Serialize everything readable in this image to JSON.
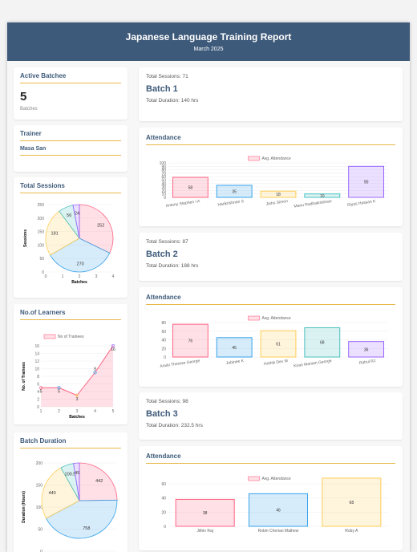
{
  "header": {
    "title": "Japanese Language Training Report",
    "subtitle": "March 2025"
  },
  "active": {
    "title": "Active Batchee",
    "count": "5",
    "label": "Batches"
  },
  "trainer": {
    "title": "Trainer",
    "name": "Masa San"
  },
  "sessions_card": {
    "title": "Total Sessions"
  },
  "learners_card": {
    "title": "No.of Learners"
  },
  "duration_card": {
    "title": "Batch Duration"
  },
  "batches": [
    {
      "sessions": "Total Sessions: 71",
      "name": "Batch 1",
      "duration": "Total Duration: 140 hrs",
      "att_title": "Attendance"
    },
    {
      "sessions": "Total Sessions: 87",
      "name": "Batch 2",
      "duration": "Total Duration: 188 hrs",
      "att_title": "Attendance"
    },
    {
      "sessions": "Total Sessions: 98",
      "name": "Batch 3",
      "duration": "Total Duration: 232.5 hrs",
      "att_title": "Attendance"
    }
  ],
  "colors": {
    "header": "#3e5a7a",
    "accent": "#e8b84a",
    "pink": "#ff6384",
    "blue": "#36a2eb",
    "yellow": "#ffce56",
    "teal": "#4bc0c0",
    "purple": "#9966ff"
  },
  "chart_data": [
    {
      "type": "pie",
      "ylabel": "Sessions",
      "xlabel": "Batches",
      "ylim": [
        0,
        250
      ],
      "xlim": [
        0,
        4
      ],
      "values": [
        252,
        270,
        181,
        56,
        24
      ]
    },
    {
      "type": "line",
      "legend": "No of Trainees",
      "ylabel": "No. of Trainees",
      "xlabel": "Batches",
      "x": [
        1,
        2,
        3,
        4,
        5
      ],
      "values": [
        5,
        5,
        3,
        9,
        16
      ],
      "ylim": [
        0,
        16
      ]
    },
    {
      "type": "pie",
      "ylabel": "Duration (Hours)",
      "ylim": [
        0,
        200
      ],
      "values": [
        442,
        758,
        440,
        100.5,
        45
      ]
    },
    {
      "type": "bar",
      "legend": "Avg. Attendance",
      "ylim": [
        0,
        100
      ],
      "categories": [
        "Antony Stephen I A",
        "Harikrishnan S",
        "Jishu Simon",
        "Manu Radhakrishnan",
        "Riyas Hassan K"
      ],
      "values": [
        58,
        35,
        18,
        10,
        90
      ]
    },
    {
      "type": "bar",
      "legend": "Avg. Attendance",
      "ylim": [
        0,
        80
      ],
      "categories": [
        "Anuki Therese George",
        "Jobinee K",
        "Hrithik Dev M",
        "Kiran Mariam George",
        "Rahul RJ"
      ],
      "values": [
        76,
        45,
        61,
        68,
        36
      ]
    },
    {
      "type": "bar",
      "legend": "Avg. Attendance",
      "ylim": [
        0,
        60
      ],
      "categories": [
        "Jithin Raj",
        "Robin Cherian Mathew",
        "Roby A"
      ],
      "values": [
        38,
        46,
        68
      ]
    }
  ]
}
